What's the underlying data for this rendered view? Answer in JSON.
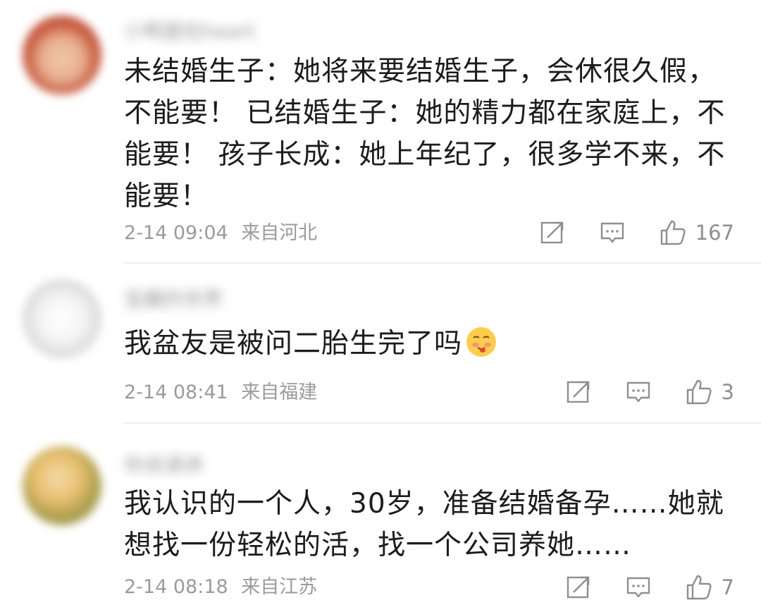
{
  "comments": [
    {
      "username": "小鸭面包heart",
      "text": "未结婚生子：她将来要结婚生子，会休很久假，不能要！ 已结婚生子：她的精力都在家庭上，不能要！ 孩子长成：她上年纪了，很多学不来，不能要！",
      "time": "2-14 09:04",
      "location": "来自河北",
      "likes": "167"
    },
    {
      "username": "宝藏的世界",
      "text": "我盆友是被问二胎生完了吗",
      "emoji": "cheeky-face-emoji",
      "time": "2-14 08:41",
      "location": "来自福建",
      "likes": "3"
    },
    {
      "username": "你说请讲",
      "text": "我认识的一个人，30岁，准备结婚备孕……她就想找一份轻松的活，找一个公司养她……",
      "time": "2-14 08:18",
      "location": "来自江苏",
      "likes": "7"
    }
  ],
  "icons": {
    "repost": "repost-icon",
    "comment": "comment-icon",
    "like": "thumbs-up-icon"
  },
  "colors": {
    "text": "#1c1c1c",
    "meta": "#9b9b9b",
    "icon": "#8f8f8f",
    "divider": "#efefef"
  }
}
